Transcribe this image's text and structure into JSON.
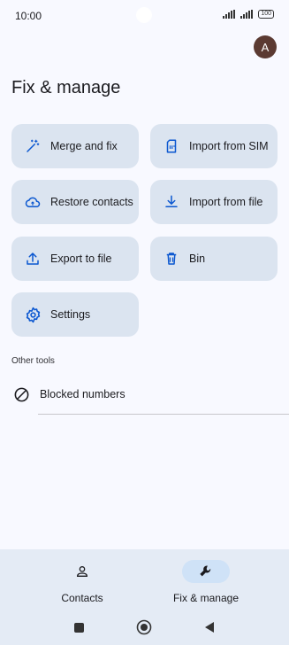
{
  "status_bar": {
    "time": "10:00",
    "battery": "100"
  },
  "header": {
    "avatar_letter": "A",
    "title": "Fix & manage"
  },
  "tiles": [
    {
      "label": "Merge and fix",
      "icon": "magic-wand-icon"
    },
    {
      "label": "Import from SIM",
      "icon": "sim-card-icon"
    },
    {
      "label": "Restore contacts",
      "icon": "cloud-restore-icon"
    },
    {
      "label": "Import from file",
      "icon": "download-icon"
    },
    {
      "label": "Export to file",
      "icon": "upload-icon"
    },
    {
      "label": "Bin",
      "icon": "bin-icon"
    },
    {
      "label": "Settings",
      "icon": "gear-icon"
    }
  ],
  "other_tools": {
    "heading": "Other tools",
    "items": [
      {
        "label": "Blocked numbers",
        "icon": "block-icon"
      }
    ]
  },
  "bottom_nav": {
    "items": [
      {
        "label": "Contacts",
        "icon": "person-icon",
        "active": false
      },
      {
        "label": "Fix & manage",
        "icon": "wrench-icon",
        "active": true
      }
    ]
  },
  "colors": {
    "accent": "#0b57d0",
    "tile_bg": "#dbe4f0",
    "active_pill": "#cfe2f7",
    "avatar_bg": "#5b3a32"
  }
}
